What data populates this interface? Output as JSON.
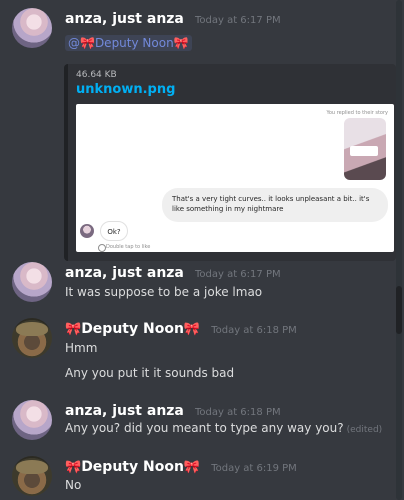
{
  "messages": [
    {
      "author": "anza, just anza",
      "timestamp": "Today at 6:17 PM",
      "mention": "@🎀Deputy Noon🎀",
      "attachment": {
        "size": "46.64 KB",
        "filename": "unknown.png",
        "screenshot": {
          "replied_text": "You replied to their story",
          "outgoing_message": "That's a very tight curves.. it looks unpleasant a bit.. it's like something in my nightmare",
          "incoming_message": "Ok?",
          "like_hint": "Double tap to like"
        }
      }
    },
    {
      "author": "anza, just anza",
      "timestamp": "Today at 6:17 PM",
      "lines": [
        "It was suppose to be a joke lmao"
      ]
    },
    {
      "author": "Deputy Noon",
      "author_deco_left": "🎀",
      "author_deco_right": "🎀",
      "timestamp": "Today at 6:18 PM",
      "lines": [
        "Hmm",
        "Any you put it it sounds bad"
      ]
    },
    {
      "author": "anza, just anza",
      "timestamp": "Today at 6:18 PM",
      "lines": [
        "Any you? did you meant to type any way you?"
      ],
      "edited": "(edited)"
    },
    {
      "author": "Deputy Noon",
      "author_deco_left": "🎀",
      "author_deco_right": "🎀",
      "timestamp": "Today at 6:19 PM",
      "lines": [
        "No"
      ]
    }
  ],
  "icons": {
    "avatar_anza": "avatar-anza",
    "avatar_noon": "avatar-noon",
    "heart": "heart-icon"
  }
}
